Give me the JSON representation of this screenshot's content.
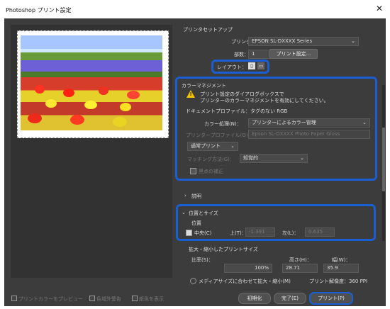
{
  "window": {
    "title": "Photoshop プリント設定",
    "close_icon": "close-icon"
  },
  "preview": {
    "paper_label": "Preview Paper"
  },
  "setup": {
    "heading": "プリンタセットアップ",
    "printer_label": "プリンター：",
    "printer_value": "EPSON SL-DXXXX Series",
    "copies_label": "部数：",
    "copies_value": "1",
    "print_settings_button": "プリント設定...",
    "layout_label": "レイアウト："
  },
  "color": {
    "heading": "カラーマネジメント",
    "warning_line1": "プリント設定のダイアログボックスで",
    "warning_line2": "プリンターのカラーマネジメントを有効にしてください。",
    "doc_profile": "ドキュメントプロファイル：タグのない RGB",
    "handling_label": "カラー処理(N)：",
    "handling_value": "プリンターによるカラー管理",
    "printer_profile_label": "プリンタープロファイル(O)：",
    "printer_profile_value": "Epson SL-DXXXX Photo Paper Gloss",
    "normal_print": "通常プリント",
    "rendering_label": "マッチング方法(G)：",
    "rendering_value": "知覚的",
    "bpc_label": "黒点の補正"
  },
  "description": {
    "heading": "説明"
  },
  "position": {
    "heading": "位置とサイズ",
    "sub": "位置",
    "center_label": "中央(C)",
    "top_label": "上(T)：",
    "top_value": "-1.391",
    "left_label": "左(L)：",
    "left_value": "0.635"
  },
  "scaled": {
    "heading": "拡大・縮小したプリントサイズ",
    "scale_label": "比率(S)：",
    "scale_value": "100%",
    "height_label": "高さ(H)：",
    "height_value": "28.71",
    "width_label": "幅(W)：",
    "width_value": "35.9",
    "fit_label": "メディアサイズに合わせて拡大・縮小(M)",
    "resolution": "プリント解像度：360 PPI"
  },
  "footer": {
    "match_colors": "プリントカラーをプレビュー",
    "gamut_warning": "色域外警告",
    "show_white": "紙色を表示",
    "reset_button": "初期化",
    "done_button": "完了(E)",
    "print_button": "プリント(P)"
  },
  "colors": {
    "highlight": "#1a5fd1",
    "panel": "#3c3c3c",
    "warning": "#f2c200"
  }
}
